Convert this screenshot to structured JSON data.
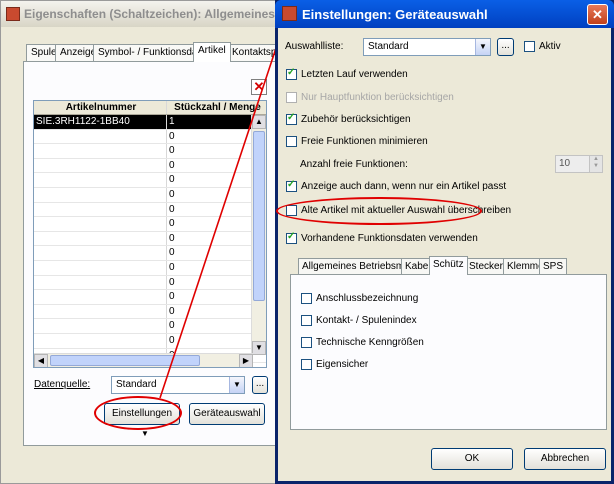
{
  "bg_window": {
    "title": "Eigenschaften (Schaltzeichen): Allgemeines Betriebsmi",
    "tabs": [
      "Spule",
      "Anzeige",
      "Symbol- / Funktionsdaten",
      "Artikel",
      "Kontaktspie"
    ],
    "table": {
      "headers": [
        "Artikelnummer",
        "Stückzahl / Menge"
      ],
      "rows": [
        [
          "SIE.3RH1122-1BB40",
          "1"
        ],
        [
          "",
          "0"
        ],
        [
          "",
          "0"
        ],
        [
          "",
          "0"
        ],
        [
          "",
          "0"
        ],
        [
          "",
          "0"
        ],
        [
          "",
          "0"
        ],
        [
          "",
          "0"
        ],
        [
          "",
          "0"
        ],
        [
          "",
          "0"
        ],
        [
          "",
          "0"
        ],
        [
          "",
          "0"
        ],
        [
          "",
          "0"
        ],
        [
          "",
          "0"
        ],
        [
          "",
          "0"
        ],
        [
          "",
          "0"
        ],
        [
          "",
          "0"
        ]
      ]
    },
    "datenquelle_label": "Datenquelle:",
    "datenquelle_value": "Standard",
    "more_button": "...",
    "einstellungen_button": "Einstellungen",
    "geraeteauswahl_button": "Geräteauswahl"
  },
  "dialog": {
    "title": "Einstellungen: Geräteauswahl",
    "auswahlliste_label": "Auswahlliste:",
    "auswahlliste_value": "Standard",
    "more_button": "...",
    "aktiv_label": "Aktiv",
    "letzten_lauf": "Letzten Lauf verwenden",
    "nur_hauptfunktion": "Nur Hauptfunktion berücksichtigen",
    "zubehoer": "Zubehör berücksichtigen",
    "freie_funktionen": "Freie Funktionen minimieren",
    "anzahl_label": "Anzahl freie Funktionen:",
    "anzahl_value": "10",
    "anzeige_auch": "Anzeige auch dann, wenn nur ein Artikel passt",
    "alte_artikel": "Alte Artikel mit aktueller Auswahl überschreiben",
    "vorhandene": "Vorhandene Funktionsdaten verwenden",
    "tabs": [
      "Allgemeines Betriebsmittel",
      "Kabel",
      "Schütz",
      "Stecker",
      "Klemme",
      "SPS"
    ],
    "schuetz_options": [
      "Anschlussbezeichnung",
      "Kontakt- / Spulenindex",
      "Technische Kenngrößen",
      "Eigensicher"
    ],
    "ok_button": "OK",
    "cancel_button": "Abbrechen"
  },
  "colors": {
    "annotation_red": "#e00000",
    "title_blue": "#0a5fe6"
  }
}
